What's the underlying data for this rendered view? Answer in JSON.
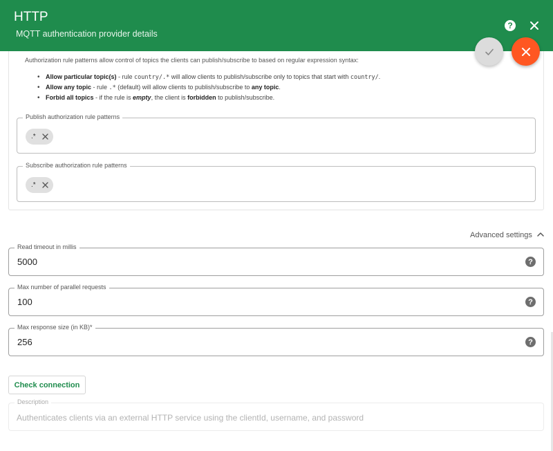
{
  "header": {
    "title": "HTTP",
    "subtitle": "MQTT authentication provider details",
    "color": "#1f8c4d"
  },
  "icons": {
    "help": "question-circle-icon",
    "close": "close-icon",
    "apply": "check-icon",
    "cancel": "close-icon",
    "chip_remove": "close-icon",
    "expand": "chevron-up-icon"
  },
  "authorization": {
    "intro": "Authorization rule patterns allow control of topics the clients can publish/subscribe to based on regular expression syntax:",
    "rules": [
      {
        "bold": "Allow particular topic(s)",
        "t1": " - rule ",
        "code": "country/.*",
        "t2": " will allow clients to publish/subscribe only to topics that start with ",
        "code2": "country/",
        "t3": "."
      },
      {
        "bold": "Allow any topic",
        "t1": " - rule ",
        "code": ".*",
        "t2": " (default) will allow clients to publish/subscribe to ",
        "bold2": "any topic",
        "t3": "."
      },
      {
        "bold": "Forbid all topics",
        "t1": " - if the rule is ",
        "em": "empty",
        "t2": ", the client is ",
        "bold2": "forbidden",
        "t3": " to publish/subscribe."
      }
    ],
    "publish": {
      "label": "Publish authorization rule patterns",
      "chips": [
        ".*"
      ]
    },
    "subscribe": {
      "label": "Subscribe authorization rule patterns",
      "chips": [
        ".*"
      ]
    }
  },
  "advanced": {
    "toggle_label": "Advanced settings",
    "fields": [
      {
        "label": "Read timeout in millis",
        "value": "5000"
      },
      {
        "label": "Max number of parallel requests",
        "value": "100"
      },
      {
        "label": "Max response size (in KB)*",
        "value": "256"
      }
    ]
  },
  "check_connection_label": "Check connection",
  "description": {
    "label": "Description",
    "value": "Authenticates clients via an external HTTP service using the clientId, username, and password"
  },
  "colors": {
    "primary": "#1f8c4d",
    "accent": "#ff5722"
  }
}
